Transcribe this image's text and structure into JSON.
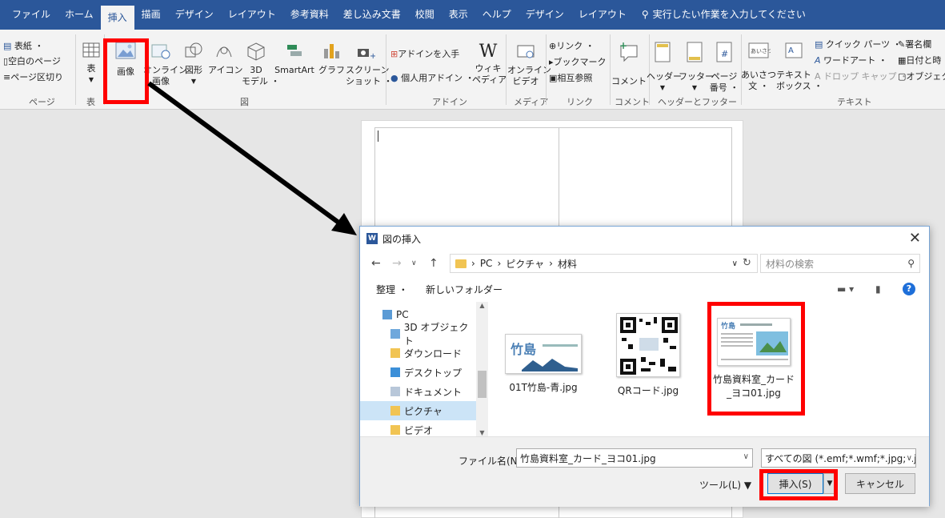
{
  "tabs": [
    "ファイル",
    "ホーム",
    "挿入",
    "描画",
    "デザイン",
    "レイアウト",
    "参考資料",
    "差し込み文書",
    "校閲",
    "表示",
    "ヘルプ"
  ],
  "context_tabs": [
    "デザイン",
    "レイアウト"
  ],
  "tell_me": "実行したい作業を入力してください",
  "ribbon": {
    "page_group": {
      "cover": "表紙 ・",
      "blank": "空白のページ",
      "break": "ページ区切り",
      "label": "ページ"
    },
    "table_group": {
      "table": "表",
      "label": "表"
    },
    "illust_group": {
      "picture": "画像",
      "online1": "オンライン",
      "online2": "画像",
      "shapes": "図形",
      "icons": "アイコン",
      "model1": "3D",
      "model2": "モデル ・",
      "smartart": "SmartArt",
      "chart": "グラフ",
      "screenshot1": "スクリーン",
      "screenshot2": "ショット ・",
      "label": "図"
    },
    "addin_group": {
      "get": "アドインを入手",
      "my": "個人用アドイン ・",
      "wiki1": "ウィキ",
      "wiki2": "ペディア",
      "label": "アドイン"
    },
    "media_group": {
      "online1": "オンライン",
      "online2": "ビデオ",
      "label": "メディア"
    },
    "link_group": {
      "link": "リンク ・",
      "bookmark": "ブックマーク",
      "crossref": "相互参照",
      "label": "リンク"
    },
    "comment_group": {
      "comment": "コメント",
      "label": "コメント"
    },
    "hf_group": {
      "header": "ヘッダー",
      "footer": "フッター",
      "page1": "ページ",
      "page2": "番号 ・",
      "label": "ヘッダーとフッター"
    },
    "text_group": {
      "greet1": "あいさつ",
      "greet2": "文 ・",
      "textbox1": "テキスト",
      "textbox2": "ボックス ・",
      "quick": "クイック パーツ ・",
      "wordart": "ワードアート ・",
      "dropcap": "ドロップ キャップ ・",
      "sign": "署名欄",
      "date": "日付と時",
      "object": "オブジェク",
      "label": "テキスト"
    }
  },
  "dialog": {
    "title": "図の挿入",
    "path": [
      "PC",
      "ピクチャ",
      "材料"
    ],
    "search_placeholder": "材料の検索",
    "organize": "整理 ・",
    "new_folder": "新しいフォルダー",
    "nav_items": [
      "PC",
      "3D オブジェクト",
      "ダウンロード",
      "デスクトップ",
      "ドキュメント",
      "ピクチャ",
      "ビデオ"
    ],
    "files": [
      {
        "name": "01T竹島-青.jpg"
      },
      {
        "name": "QRコード.jpg"
      },
      {
        "name1": "竹島資料室_カード",
        "name2": "_ヨコ01.jpg"
      }
    ],
    "filename_label": "ファイル名(N):",
    "filename_value": "竹島資料室_カード_ヨコ01.jpg",
    "filter": "すべての図 (*.emf;*.wmf;*.jpg;*.jp",
    "tools": "ツール(L) ▼",
    "insert": "挿入(S)",
    "cancel": "キャンセル"
  },
  "colors": {
    "accent": "#2b579a",
    "highlight": "#ff0000"
  }
}
